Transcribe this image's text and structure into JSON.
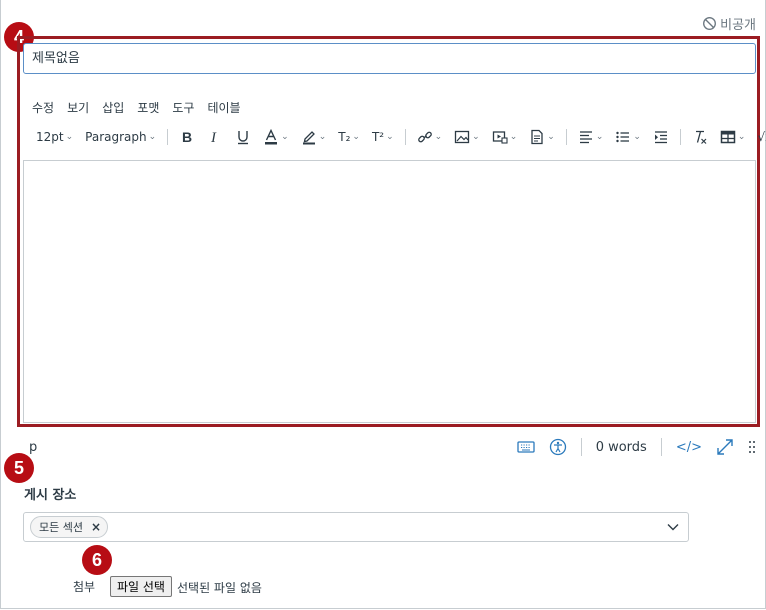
{
  "header": {
    "private_label": "비공개"
  },
  "badges": {
    "editor": "4",
    "post_to": "5",
    "attach": "6"
  },
  "title_input": {
    "placeholder": "제목없음"
  },
  "menubar": {
    "items": [
      "수정",
      "보기",
      "삽입",
      "포맷",
      "도구",
      "테이블"
    ]
  },
  "toolbar": {
    "font_size": "12pt",
    "block_format": "Paragraph",
    "subscript_label": "T₂",
    "superscript_label": "T²",
    "sqrt_label": "√x"
  },
  "statusbar": {
    "path": "p",
    "word_count": "0 words",
    "html_toggle": "</>"
  },
  "post_to": {
    "label": "게시 장소",
    "chip": "모든 섹션",
    "chip_remove": "×"
  },
  "attach": {
    "label": "첨부",
    "button": "파일 선택",
    "no_file": "선택된 파일 없음"
  },
  "colors": {
    "accent": "#2b7abc",
    "badge": "#b70d14",
    "highlight": "#9b1c22"
  }
}
